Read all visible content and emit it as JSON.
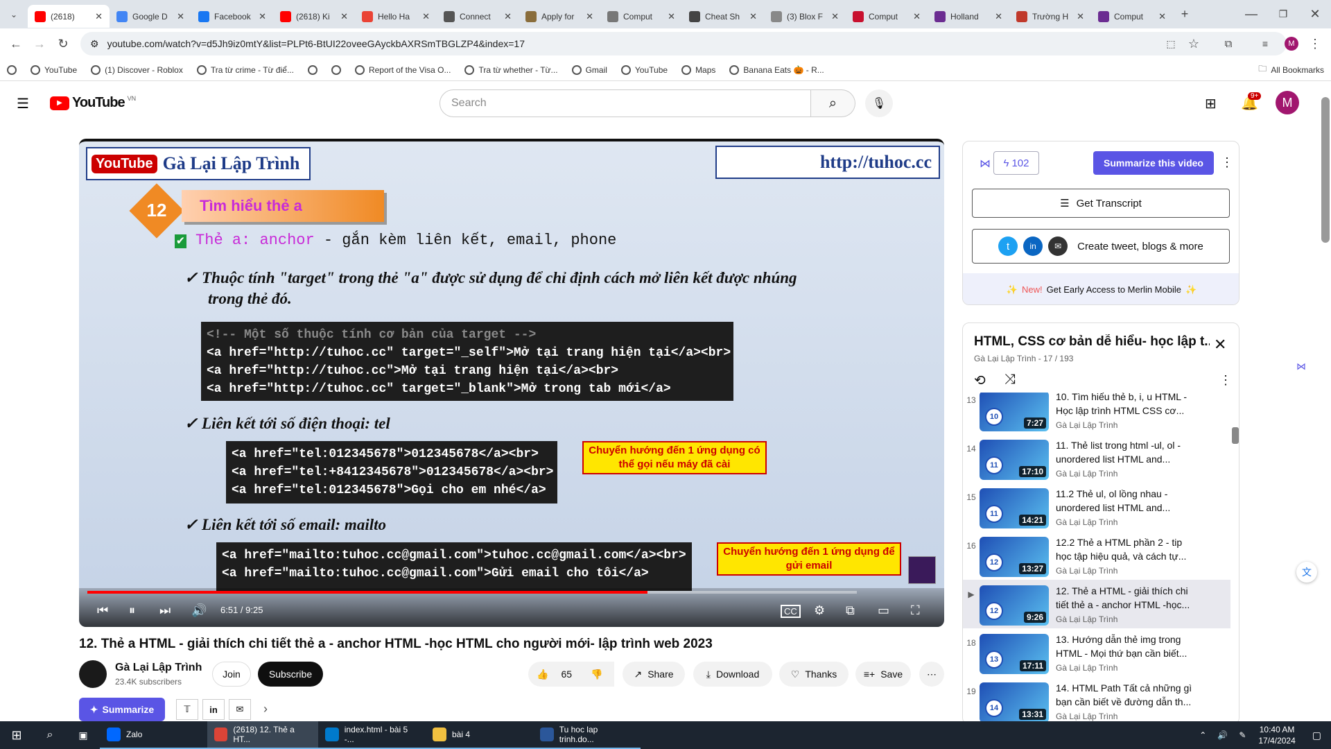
{
  "tabs": [
    {
      "label": "(2618)",
      "fav_color": "#ff0000",
      "active": true
    },
    {
      "label": "Google D",
      "fav_color": "#4285f4"
    },
    {
      "label": "Facebook",
      "fav_color": "#1877f2"
    },
    {
      "label": "(2618) Ki",
      "fav_color": "#ff0000"
    },
    {
      "label": "Hello Ha",
      "fav_color": "#ea4335"
    },
    {
      "label": "Connect",
      "fav_color": "#555555"
    },
    {
      "label": "Apply for",
      "fav_color": "#8a6d3b"
    },
    {
      "label": "Comput",
      "fav_color": "#777777"
    },
    {
      "label": "Cheat Sh",
      "fav_color": "#444444"
    },
    {
      "label": "(3) Blox F",
      "fav_color": "#888888"
    },
    {
      "label": "Comput",
      "fav_color": "#c8102e"
    },
    {
      "label": "Holland",
      "fav_color": "#6b2c91"
    },
    {
      "label": "Trường H",
      "fav_color": "#c0392b"
    },
    {
      "label": "Comput",
      "fav_color": "#6b2c91"
    }
  ],
  "browser": {
    "url": "youtube.com/watch?v=d5Jh9iz0mtY&list=PLPt6-BtUI22oveeGAyckbAXRSmTBGLZP4&index=17"
  },
  "bookmarks": [
    "YouTube",
    "(1) Discover - Roblox",
    "Tra từ crime - Từ điể...",
    "",
    "",
    "Report of the Visa O...",
    "Tra từ whether - Từ...",
    "Gmail",
    "YouTube",
    "Maps",
    "Banana Eats 🎃 - R..."
  ],
  "all_bookmarks": "All Bookmarks",
  "yt": {
    "logo": "YouTube",
    "region": "VN",
    "search_placeholder": "Search",
    "notif_count": "9+",
    "avatar": "M"
  },
  "slide": {
    "brand": "Gà Lại Lập Trình",
    "site": "http://tuhoc.cc",
    "yt_badge": "YouTube",
    "num": "12",
    "heading": "Tìm hiểu thẻ a",
    "sub_a": "Thẻ a:",
    "sub_b": "anchor",
    "sub_c": " - gắn kèm liên kết, email, phone",
    "b1": "Thuộc tính \"target\" trong thẻ \"a\" được sử dụng để chỉ định cách mở liên kết được nhúng",
    "b1b": "trong thẻ đó.",
    "code1": [
      "<!-- Một số thuộc tính cơ bản của target -->",
      "<a href=\"http://tuhoc.cc\" target=\"_self\">Mở tại trang hiện tại</a><br>",
      "<a href=\"http://tuhoc.cc\">Mở tại trang hiện tại</a><br>",
      "<a href=\"http://tuhoc.cc\" target=\"_blank\">Mở trong tab mới</a>"
    ],
    "b2": "Liên kết tới số điện thoại: tel",
    "code2": [
      "<a href=\"tel:012345678\">012345678</a><br>",
      "<a href=\"tel:+8412345678\">012345678</a><br>",
      "<a href=\"tel:012345678\">Gọi cho em nhé</a>"
    ],
    "note2": "Chuyển hướng đến 1 ứng dụng có thể gọi nếu máy đã cài",
    "b3": "Liên kết tới số email: mailto",
    "code3": [
      "<a href=\"mailto:tuhoc.cc@gmail.com\">tuhoc.cc@gmail.com</a><br>",
      "<a href=\"mailto:tuhoc.cc@gmail.com\">Gửi email cho tôi</a>"
    ],
    "note3": "Chuyển hướng đến 1 ứng dụng để gửi email"
  },
  "player": {
    "time": "6:51 / 9:25",
    "progress": 0.728
  },
  "video": {
    "title": "12. Thẻ a HTML - giải thích chi tiết thẻ a - anchor HTML -học HTML cho người mới- lập trình web 2023",
    "channel": "Gà Lại Lập Trình",
    "subs": "23.4K subscribers",
    "join": "Join",
    "subscribe": "Subscribe",
    "likes": "65",
    "share": "Share",
    "download": "Download",
    "thanks": "Thanks",
    "save": "Save",
    "summarize": "Summarize"
  },
  "merlin": {
    "count": "102",
    "summarize": "Summarize this video",
    "transcript": "Get Transcript",
    "create": "Create tweet, blogs & more",
    "new": "New!",
    "promo": "Get Early Access to Merlin Mobile"
  },
  "playlist": {
    "title": "HTML, CSS cơ bản dễ hiểu- học lập t...",
    "meta": "Gà Lại Lập Trình - 17 / 193",
    "items": [
      {
        "n": "13",
        "title": "10. Tìm hiểu thẻ b, i, u HTML - Học lập trình HTML CSS cơ...",
        "ch": "Gà Lại Lập Trình",
        "dur": "7:27",
        "badge": "10"
      },
      {
        "n": "14",
        "title": "11. Thẻ list trong html -ul, ol - unordered list HTML and...",
        "ch": "Gà Lại Lập Trình",
        "dur": "17:10",
        "badge": "11"
      },
      {
        "n": "15",
        "title": "11.2 Thẻ ul, ol lồng nhau - unordered list HTML and...",
        "ch": "Gà Lại Lập Trình",
        "dur": "14:21",
        "badge": "11"
      },
      {
        "n": "16",
        "title": "12.2 Thẻ a HTML phần 2 - tip học tập hiệu quả, và cách tự...",
        "ch": "Gà Lại Lập Trình",
        "dur": "13:27",
        "badge": "12"
      },
      {
        "n": "▶",
        "title": "12. Thẻ a HTML - giải thích chi tiết thẻ a - anchor HTML -học...",
        "ch": "Gà Lại Lập Trình",
        "dur": "9:26",
        "badge": "12",
        "current": true
      },
      {
        "n": "18",
        "title": "13. Hướng dẫn thẻ img trong HTML - Mọi thứ bạn cần biết...",
        "ch": "Gà Lại Lập Trình",
        "dur": "17:11",
        "badge": "13"
      },
      {
        "n": "19",
        "title": "14. HTML Path Tất cả những gì bạn cần biết về đường dẫn th...",
        "ch": "Gà Lại Lập Trình",
        "dur": "13:31",
        "badge": "14"
      }
    ]
  },
  "taskbar": {
    "apps": [
      "Zalo",
      "(2618) 12. Thẻ a HT...",
      "index.html - bài 5 -...",
      "bài 4",
      "Tu hoc lap trinh.do..."
    ],
    "time": "10:40 AM",
    "date": "17/4/2024"
  }
}
